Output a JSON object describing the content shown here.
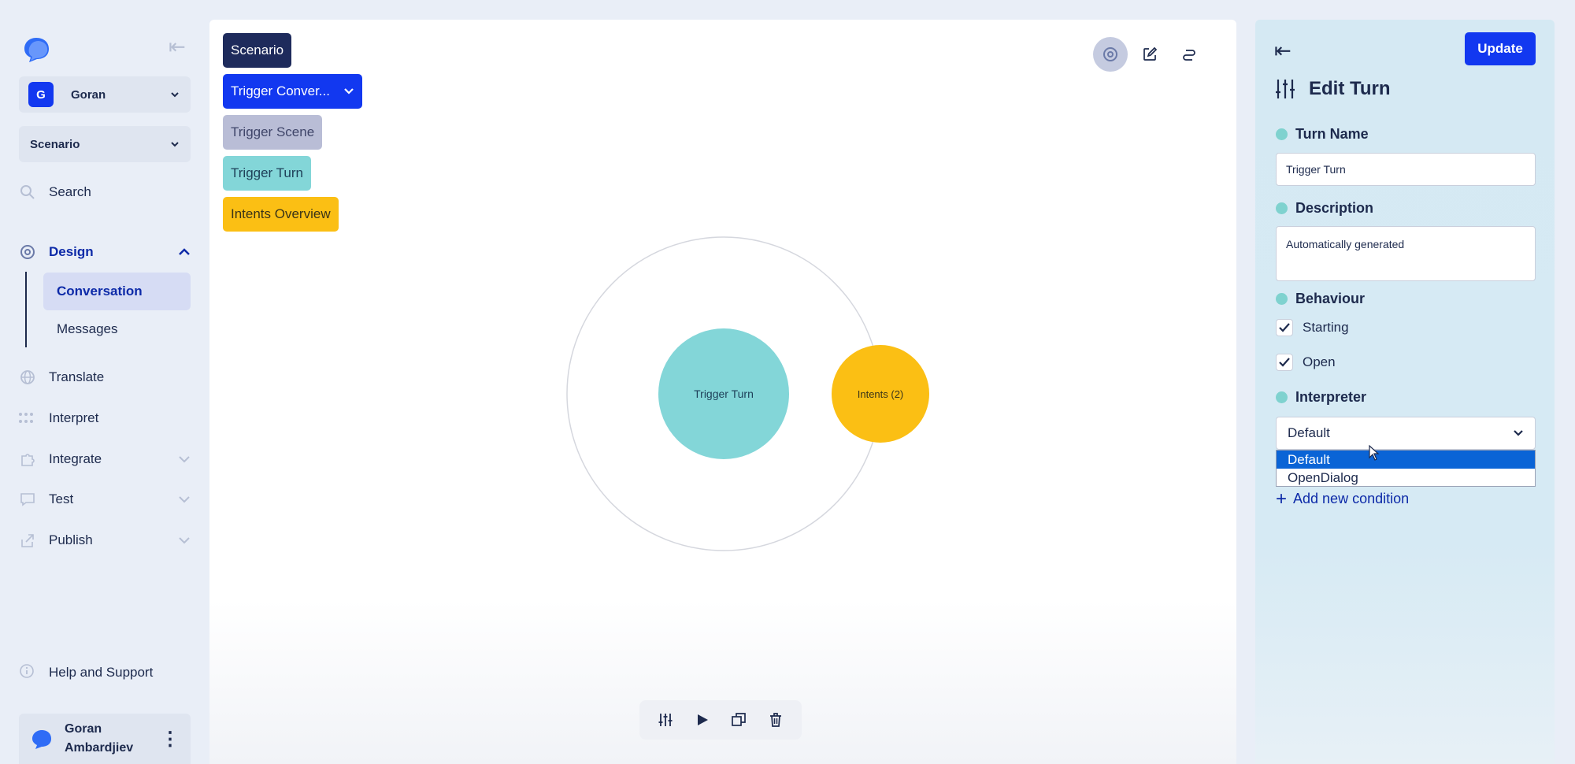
{
  "sidebar": {
    "workspace": {
      "initial": "G",
      "name": "Goran"
    },
    "scenario_select": "Scenario",
    "search_label": "Search",
    "nav": {
      "design": "Design",
      "conversation": "Conversation",
      "messages": "Messages",
      "translate": "Translate",
      "interpret": "Interpret",
      "integrate": "Integrate",
      "test": "Test",
      "publish": "Publish"
    },
    "help_label": "Help and Support",
    "user": {
      "name": "Goran Ambardjiev"
    }
  },
  "canvas": {
    "breadcrumbs": {
      "scenario": "Scenario",
      "conversation": "Trigger Conver...",
      "scene": "Trigger Scene",
      "turn": "Trigger Turn",
      "intents": "Intents Overview"
    },
    "graph": {
      "center_node": "Trigger Turn",
      "intents_node": "Intents (2)"
    }
  },
  "panel": {
    "update_label": "Update",
    "title": "Edit Turn",
    "turn_name_label": "Turn Name",
    "turn_name_value": "Trigger Turn",
    "description_label": "Description",
    "description_value": "Automatically generated",
    "behaviour_label": "Behaviour",
    "behaviour_options": [
      {
        "label": "Starting",
        "checked": true
      },
      {
        "label": "Open",
        "checked": true
      }
    ],
    "interpreter_label": "Interpreter",
    "interpreter_value": "Default",
    "interpreter_options": [
      "Default",
      "OpenDialog"
    ],
    "add_condition_label": "Add new condition"
  },
  "colors": {
    "primary": "#1238f0",
    "navy": "#1e2b5c",
    "teal": "#83d6d8",
    "amber": "#fbbf14",
    "scene": "#b9bdd6",
    "panel_bg": "#d5e9f3"
  }
}
